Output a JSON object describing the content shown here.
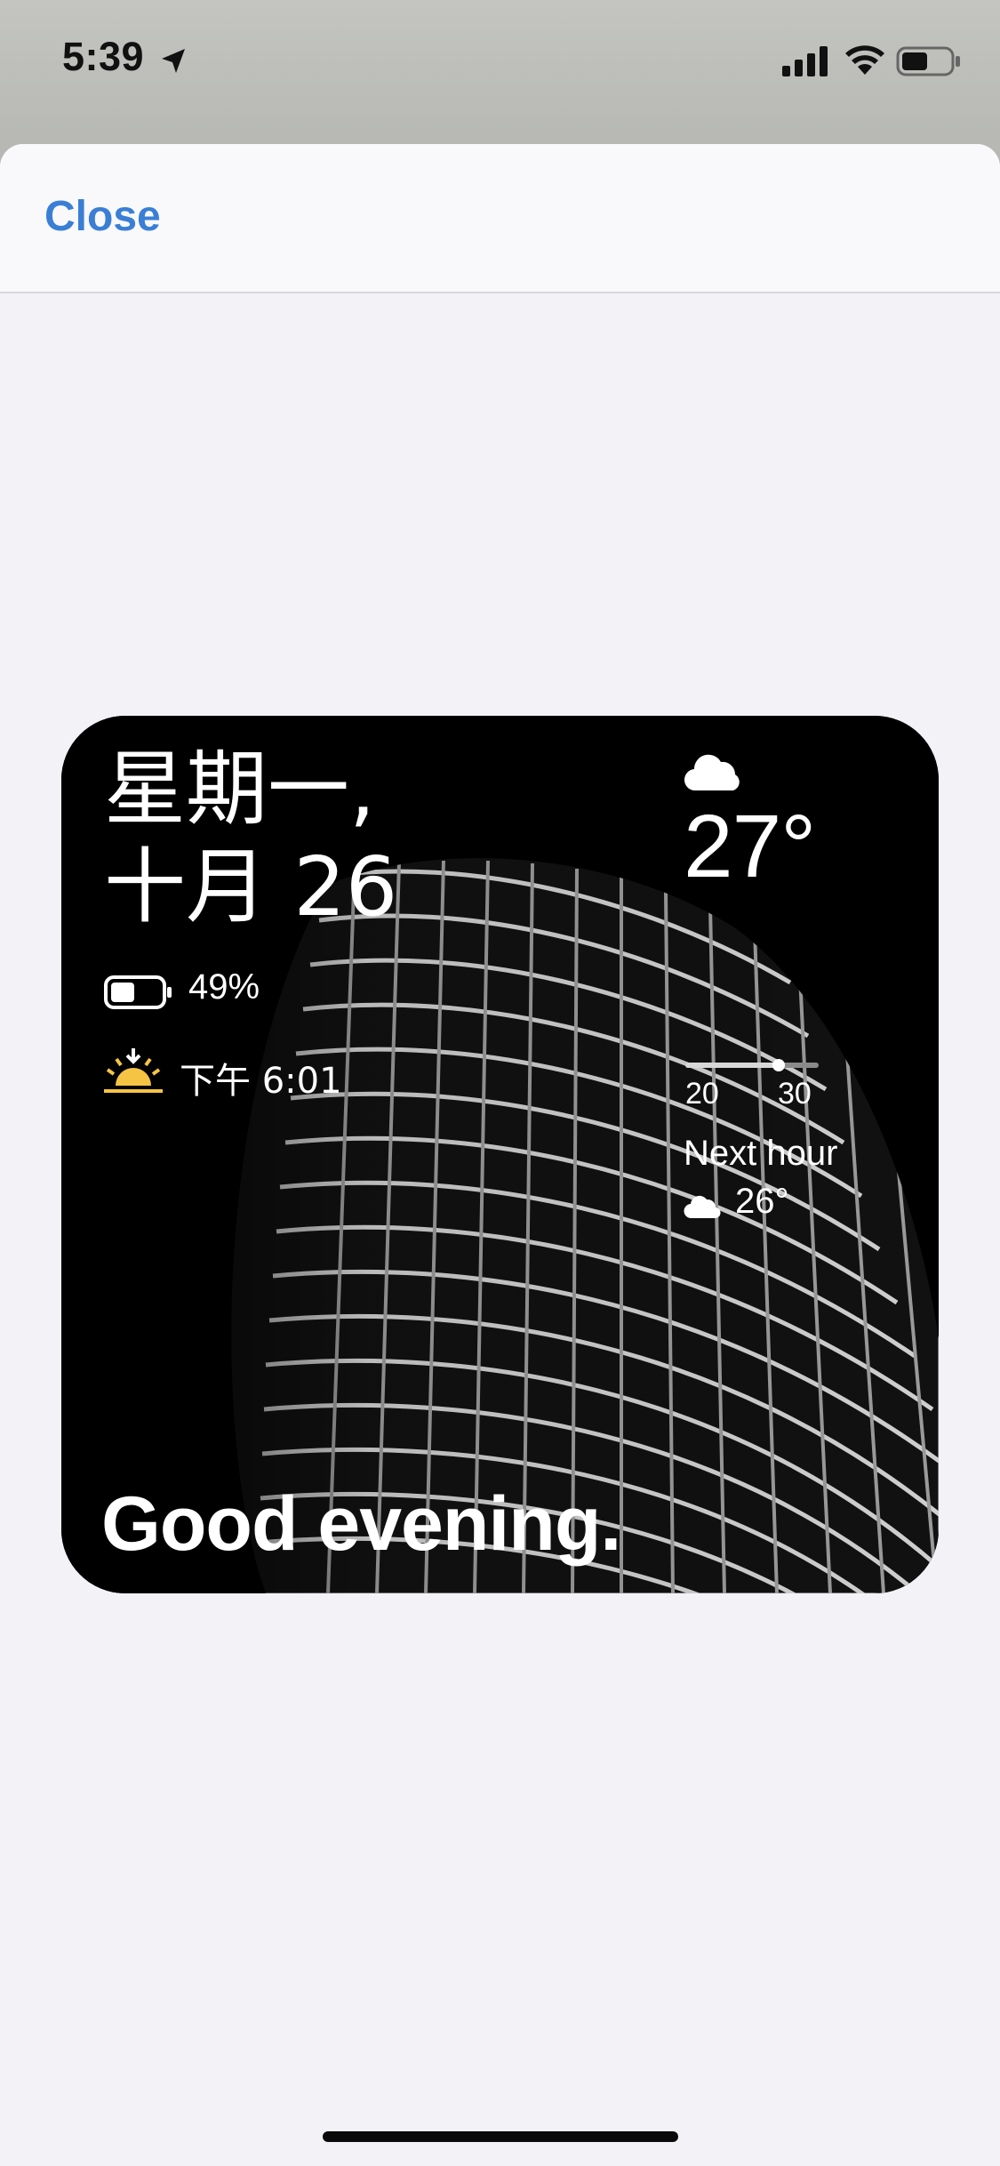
{
  "status_bar": {
    "time": "5:39"
  },
  "sheet": {
    "close_label": "Close"
  },
  "widget": {
    "date_line1": "星期一,",
    "date_line2": "十月 26",
    "battery_percent": "49%",
    "battery_level": 0.49,
    "sunset_time": "下午 6:01",
    "temperature": "27°",
    "range_min": "20",
    "range_max": "30",
    "range_current_fraction": 0.7,
    "next_hour_label": "Next hour",
    "next_hour_temp": "26°",
    "greeting": "Good evening."
  },
  "colors": {
    "accent": "#3a7fd5",
    "sunset_icon": "#f6c445",
    "sheet_background": "#f2f2f7"
  },
  "icons": {
    "location": "location-arrow-icon",
    "signal": "cellular-signal-icon",
    "wifi": "wifi-icon",
    "battery": "battery-icon",
    "weather_top": "cloud-icon",
    "sunset": "sunset-icon",
    "next_hour_weather": "cloud-icon"
  }
}
